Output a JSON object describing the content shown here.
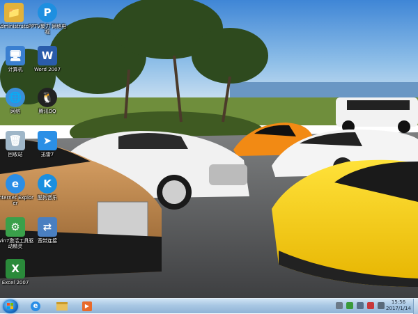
{
  "desktop": {
    "icons": [
      {
        "id": "administrator",
        "label": "Administrator",
        "icon": "user-folder-icon",
        "color": "#e2b23a"
      },
      {
        "id": "pptv",
        "label": "PPTV聚力 网络电视",
        "icon": "pptv-icon",
        "color": "#1e8fe0"
      },
      {
        "id": "computer",
        "label": "计算机",
        "icon": "computer-icon",
        "color": "#3a7fd0"
      },
      {
        "id": "word2007",
        "label": "Word 2007",
        "icon": "word-icon",
        "color": "#2a5caa"
      },
      {
        "id": "network",
        "label": "网络",
        "icon": "network-icon",
        "color": "#3a8fd8"
      },
      {
        "id": "qq",
        "label": "腾讯QQ",
        "icon": "qq-penguin-icon",
        "color": "#222222"
      },
      {
        "id": "recycle",
        "label": "回收站",
        "icon": "recycle-bin-icon",
        "color": "#9fb6c8"
      },
      {
        "id": "xunlei",
        "label": "迅雷7",
        "icon": "xunlei-icon",
        "color": "#2a8fe6"
      },
      {
        "id": "ie",
        "label": "Internet Explorer",
        "icon": "internet-explorer-icon",
        "color": "#2b8ee6"
      },
      {
        "id": "kugou",
        "label": "酷狗音乐",
        "icon": "kugou-icon",
        "color": "#1a8fe0"
      },
      {
        "id": "win7tool",
        "label": "Win7激活工具驱动精灵",
        "icon": "tool-icon",
        "color": "#3aa04a"
      },
      {
        "id": "broadband",
        "label": "宽带连接",
        "icon": "broadband-icon",
        "color": "#4a7fc0"
      },
      {
        "id": "excel2007",
        "label": "Excel 2007",
        "icon": "excel-icon",
        "color": "#2a8a3a"
      }
    ]
  },
  "taskbar": {
    "start": {
      "icon": "windows-start-orb-icon"
    },
    "pinned": [
      {
        "id": "ie",
        "icon": "internet-explorer-icon"
      },
      {
        "id": "explorer",
        "icon": "folder-explorer-icon"
      },
      {
        "id": "media",
        "icon": "media-player-icon"
      }
    ],
    "tray": [
      {
        "id": "keyboard",
        "icon": "keyboard-icon",
        "color": "#6c7a88"
      },
      {
        "id": "security",
        "icon": "shield-icon",
        "color": "#3a9a3a"
      },
      {
        "id": "network",
        "icon": "network-tray-icon",
        "color": "#58708a"
      },
      {
        "id": "flag",
        "icon": "action-center-flag-icon",
        "color": "#c8383a"
      },
      {
        "id": "volume",
        "icon": "speaker-icon",
        "color": "#5a6a7a"
      }
    ],
    "clock": {
      "time": "15:56",
      "date": "2017/1/14"
    }
  }
}
